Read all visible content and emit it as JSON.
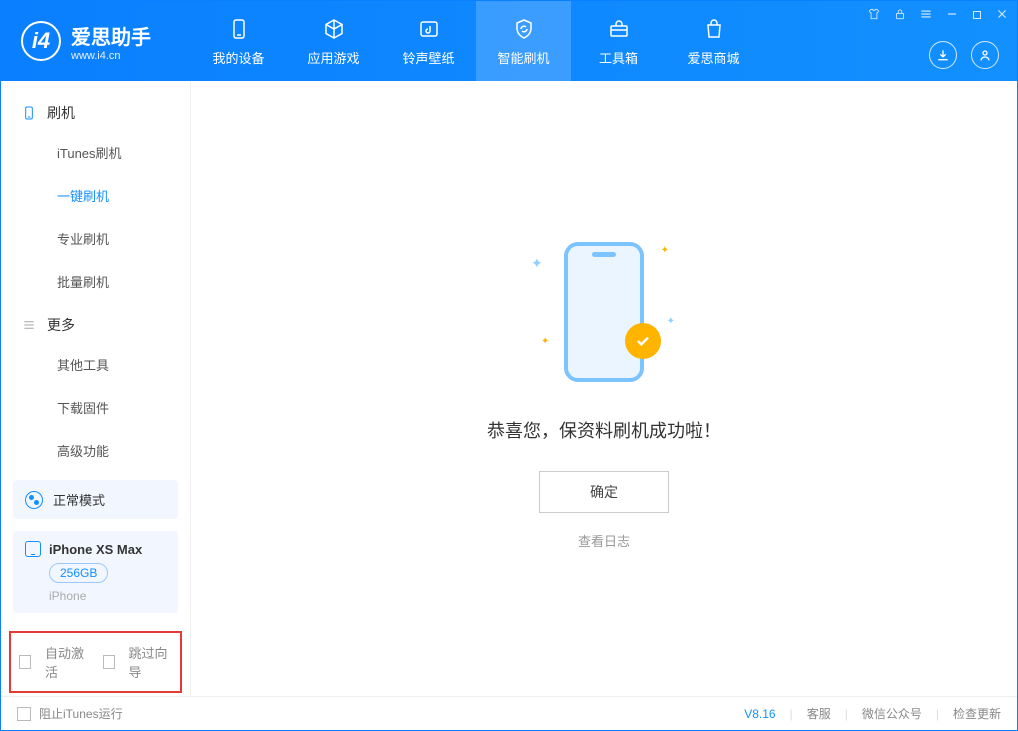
{
  "app": {
    "name": "爱思助手",
    "url": "www.i4.cn"
  },
  "nav": {
    "tabs": [
      {
        "label": "我的设备"
      },
      {
        "label": "应用游戏"
      },
      {
        "label": "铃声壁纸"
      },
      {
        "label": "智能刷机"
      },
      {
        "label": "工具箱"
      },
      {
        "label": "爱思商城"
      }
    ]
  },
  "sidebar": {
    "group1": {
      "title": "刷机"
    },
    "items1": [
      {
        "label": "iTunes刷机"
      },
      {
        "label": "一键刷机"
      },
      {
        "label": "专业刷机"
      },
      {
        "label": "批量刷机"
      }
    ],
    "group2": {
      "title": "更多"
    },
    "items2": [
      {
        "label": "其他工具"
      },
      {
        "label": "下载固件"
      },
      {
        "label": "高级功能"
      }
    ],
    "mode": {
      "label": "正常模式"
    },
    "device": {
      "name": "iPhone XS Max",
      "capacity": "256GB",
      "type": "iPhone"
    },
    "opts": {
      "auto_activate": "自动激活",
      "skip_wizard": "跳过向导"
    }
  },
  "main": {
    "success_text": "恭喜您，保资料刷机成功啦！",
    "ok_button": "确定",
    "view_log": "查看日志"
  },
  "statusbar": {
    "block_itunes": "阻止iTunes运行",
    "version": "V8.16",
    "link_service": "客服",
    "link_wechat": "微信公众号",
    "link_update": "检查更新"
  }
}
